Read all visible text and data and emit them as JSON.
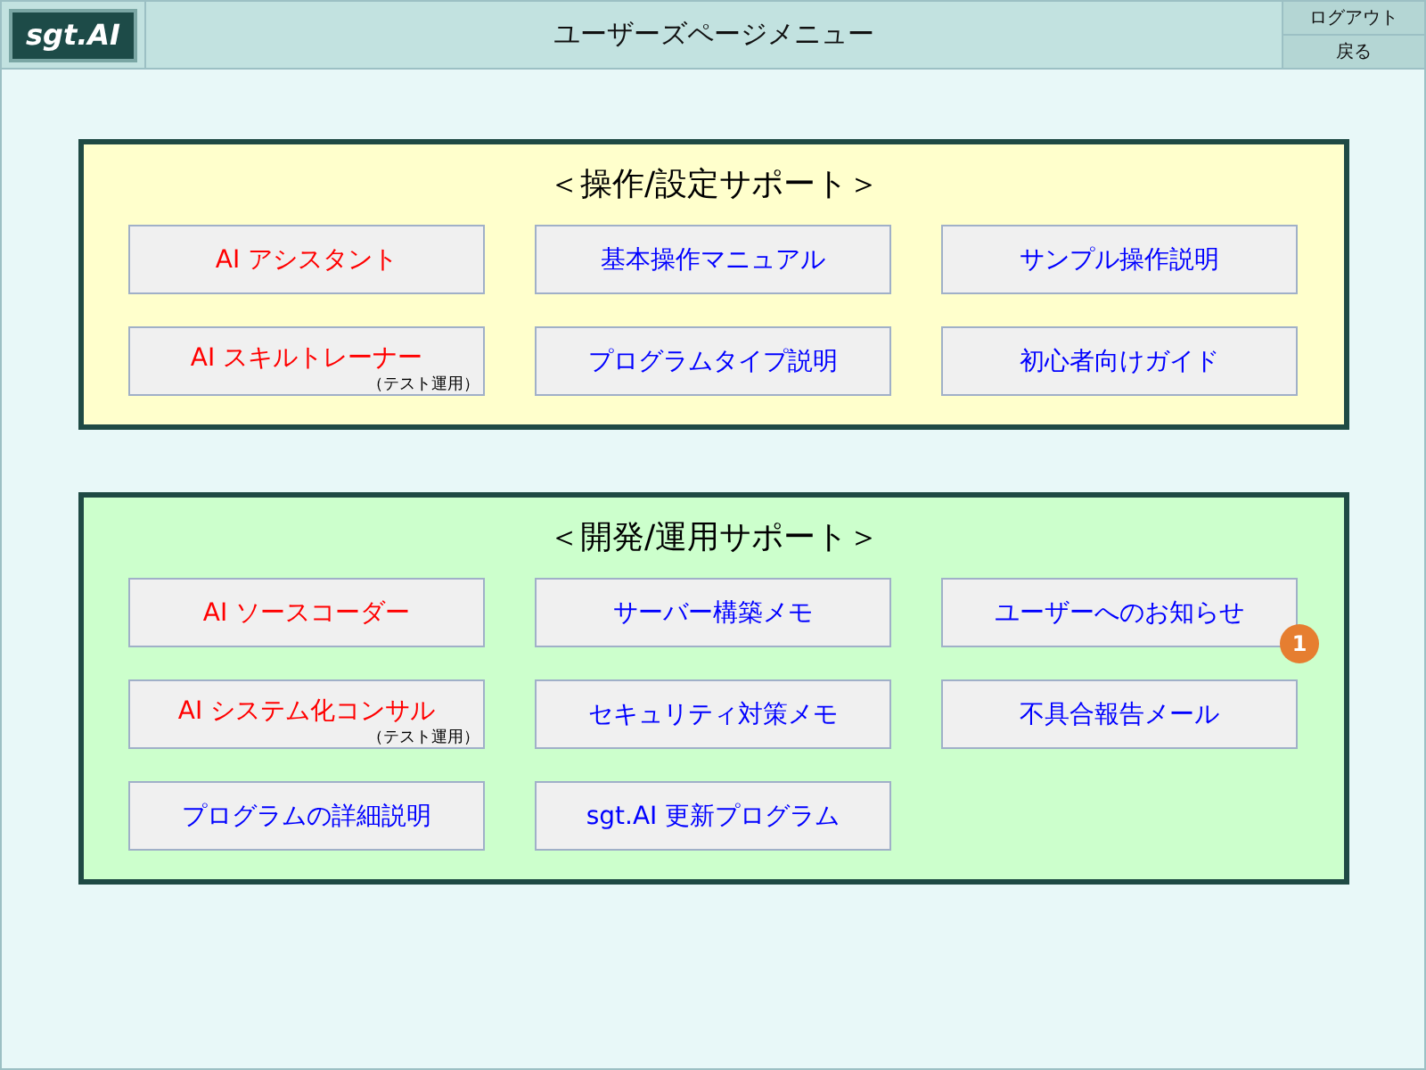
{
  "header": {
    "logo": "sgt.AI",
    "title": "ユーザーズページメニュー",
    "buttons": [
      "ログアウト",
      "戻る"
    ]
  },
  "sections": [
    {
      "title": "＜操作/設定サポート＞",
      "color": "#ffffcc",
      "items": [
        {
          "label": "AI アシスタント",
          "color": "#ff0000"
        },
        {
          "label": "基本操作マニュアル",
          "color": "#0000ff"
        },
        {
          "label": "サンプル操作説明",
          "color": "#0000ff"
        },
        {
          "label": "AI スキルトレーナー",
          "note": "（テスト運用）",
          "color": "#ff0000"
        },
        {
          "label": "プログラムタイプ説明",
          "color": "#0000ff"
        },
        {
          "label": "初心者向けガイド",
          "color": "#0000ff"
        }
      ]
    },
    {
      "title": "＜開発/運用サポート＞",
      "color": "#ccffcc",
      "items": [
        {
          "label": "AI ソースコーダー",
          "color": "#ff0000"
        },
        {
          "label": "サーバー構築メモ",
          "color": "#0000ff"
        },
        {
          "label": "ユーザーへのお知らせ",
          "badge": "1",
          "color": "#0000ff"
        },
        {
          "label": "AI システム化コンサル",
          "note": "（テスト運用）",
          "color": "#ff0000"
        },
        {
          "label": "セキュリティ対策メモ",
          "color": "#0000ff"
        },
        {
          "label": "不具合報告メール",
          "color": "#0000ff"
        },
        {
          "label": "プログラムの詳細説明",
          "color": "#0000ff"
        },
        {
          "label": "sgt.AI 更新プログラム",
          "color": "#0000ff"
        }
      ]
    }
  ]
}
